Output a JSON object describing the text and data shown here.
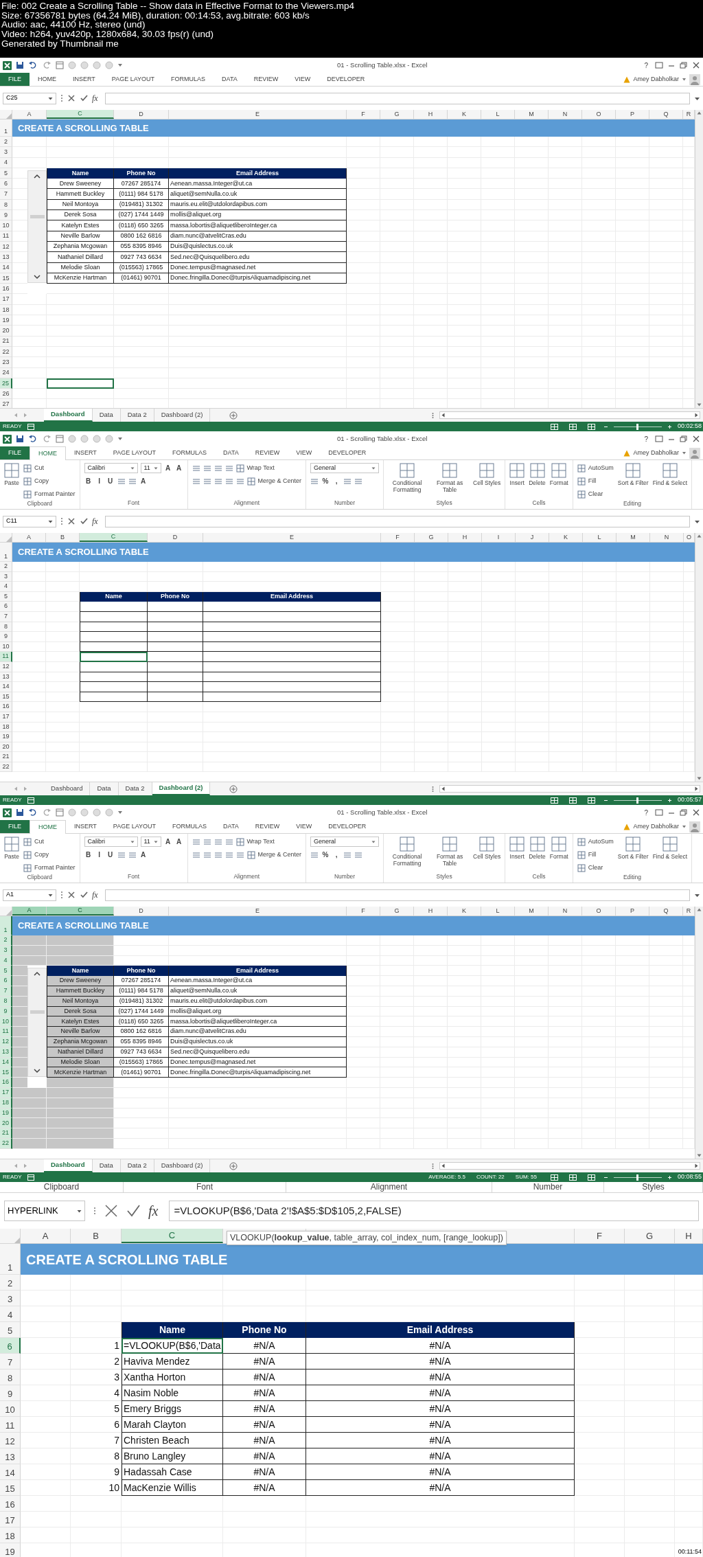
{
  "video_info": [
    "File: 002 Create a Scrolling Table -- Show data in Effective Format to the Viewers.mp4",
    "Size: 67356781 bytes (64.24 MiB), duration: 00:14:53, avg.bitrate: 603 kb/s",
    "Audio: aac, 44100 Hz, stereo (und)",
    "Video: h264, yuv420p, 1280x684, 30.03 fps(r) (und)",
    "Generated by Thumbnail me"
  ],
  "frames": [
    {
      "kind": "window",
      "timestamp": "00:02:58",
      "window": {
        "title": "01 - Scrolling Table.xlsx - Excel",
        "help": "?",
        "user": "Amey Dabholkar"
      },
      "file_button": {
        "label": "FILE"
      },
      "ribbon_tabs": [
        {
          "label": "HOME",
          "selected": false
        },
        {
          "label": "INSERT",
          "selected": false
        },
        {
          "label": "PAGE LAYOUT",
          "selected": false
        },
        {
          "label": "FORMULAS",
          "selected": false
        },
        {
          "label": "DATA",
          "selected": false
        },
        {
          "label": "REVIEW",
          "selected": false
        },
        {
          "label": "VIEW",
          "selected": false
        },
        {
          "label": "DEVELOPER",
          "selected": false
        }
      ],
      "formula_bar": {
        "name_box": "C25",
        "function_label": "fx"
      },
      "sheet": {
        "banner": "CREATE A SCROLLING TABLE",
        "scroll_control": true,
        "columns": [
          {
            "label": "A",
            "selected": false
          },
          {
            "label": "C",
            "selected": true
          },
          {
            "label": "D",
            "selected": false
          },
          {
            "label": "E",
            "selected": false
          },
          {
            "label": "F",
            "selected": false
          },
          {
            "label": "G",
            "selected": false
          },
          {
            "label": "H",
            "selected": false
          },
          {
            "label": "K",
            "selected": false
          },
          {
            "label": "L",
            "selected": false
          },
          {
            "label": "M",
            "selected": false
          },
          {
            "label": "N",
            "selected": false
          },
          {
            "label": "O",
            "selected": false
          },
          {
            "label": "P",
            "selected": false
          },
          {
            "label": "Q",
            "selected": false
          },
          {
            "label": "R",
            "selected": false
          }
        ],
        "rows": [
          {
            "label": "1",
            "selected": false
          },
          {
            "label": "2",
            "selected": false
          },
          {
            "label": "3",
            "selected": false
          },
          {
            "label": "4",
            "selected": false
          },
          {
            "label": "5",
            "selected": false
          },
          {
            "label": "6",
            "selected": false
          },
          {
            "label": "7",
            "selected": false
          },
          {
            "label": "8",
            "selected": false
          },
          {
            "label": "9",
            "selected": false
          },
          {
            "label": "10",
            "selected": false
          },
          {
            "label": "11",
            "selected": false
          },
          {
            "label": "12",
            "selected": false
          },
          {
            "label": "13",
            "selected": false
          },
          {
            "label": "14",
            "selected": false
          },
          {
            "label": "15",
            "selected": false
          },
          {
            "label": "16",
            "selected": false
          },
          {
            "label": "17",
            "selected": false
          },
          {
            "label": "18",
            "selected": false
          },
          {
            "label": "19",
            "selected": false
          },
          {
            "label": "20",
            "selected": false
          },
          {
            "label": "21",
            "selected": false
          },
          {
            "label": "22",
            "selected": false
          },
          {
            "label": "23",
            "selected": false
          },
          {
            "label": "24",
            "selected": false
          },
          {
            "label": "25",
            "selected": true
          },
          {
            "label": "26",
            "selected": false
          },
          {
            "label": "27",
            "selected": false
          }
        ],
        "table": {
          "columns": [
            "Name",
            "Phone No",
            "Email Address"
          ],
          "rows": [
            {
              "name": "Drew Sweeney",
              "phone": "07267 285174",
              "email": "Aenean.massa.Integer@ut.ca"
            },
            {
              "name": "Hammett Buckley",
              "phone": "(0111) 984 5178",
              "email": "aliquet@semNulla.co.uk"
            },
            {
              "name": "Neil Montoya",
              "phone": "(019481) 31302",
              "email": "mauris.eu.elit@utdolordapibus.com"
            },
            {
              "name": "Derek Sosa",
              "phone": "(027) 1744 1449",
              "email": "mollis@aliquet.org"
            },
            {
              "name": "Katelyn Estes",
              "phone": "(0118) 650 3265",
              "email": "massa.lobortis@aliquetliberoInteger.ca"
            },
            {
              "name": "Neville Barlow",
              "phone": "0800 162 6816",
              "email": "diam.nunc@atvelitCras.edu"
            },
            {
              "name": "Zephania Mcgowan",
              "phone": "055 8395 8946",
              "email": "Duis@quislectus.co.uk"
            },
            {
              "name": "Nathaniel Dillard",
              "phone": "0927 743 6634",
              "email": "Sed.nec@Quisquelibero.edu"
            },
            {
              "name": "Melodie Sloan",
              "phone": "(015563) 17865",
              "email": "Donec.tempus@magnased.net"
            },
            {
              "name": "McKenzie Hartman",
              "phone": "(01461) 90701",
              "email": "Donec.fringilla.Donec@turpisAliquamadipiscing.net"
            }
          ]
        }
      },
      "sheet_tabs": [
        {
          "label": "Dashboard",
          "selected": true
        },
        {
          "label": "Data",
          "selected": false
        },
        {
          "label": "Data 2",
          "selected": false
        },
        {
          "label": "Dashboard (2)",
          "selected": false
        }
      ],
      "status_bar": {
        "mode": "READY",
        "zoom": {
          "level": 0.5
        }
      }
    },
    {
      "kind": "window",
      "timestamp": "00:05:57",
      "window": {
        "title": "01 - Scrolling Table.xlsx - Excel",
        "help": "?",
        "user": "Amey Dabholkar"
      },
      "file_button": {
        "label": "FILE"
      },
      "ribbon_tabs": [
        {
          "label": "HOME",
          "selected": true
        },
        {
          "label": "INSERT",
          "selected": false
        },
        {
          "label": "PAGE LAYOUT",
          "selected": false
        },
        {
          "label": "FORMULAS",
          "selected": false
        },
        {
          "label": "DATA",
          "selected": false
        },
        {
          "label": "REVIEW",
          "selected": false
        },
        {
          "label": "VIEW",
          "selected": false
        },
        {
          "label": "DEVELOPER",
          "selected": false
        }
      ],
      "ribbon": {
        "groups": [
          {
            "label": "Clipboard",
            "items": [
              {
                "kind": "large",
                "label": "Paste"
              },
              {
                "kind": "stack",
                "lines": [
                  {
                    "tools": [
                      {
                        "kind": "labeled",
                        "label": "Cut"
                      }
                    ]
                  },
                  {
                    "tools": [
                      {
                        "kind": "labeled",
                        "label": "Copy"
                      }
                    ]
                  },
                  {
                    "tools": [
                      {
                        "kind": "labeled",
                        "label": "Format Painter"
                      }
                    ]
                  }
                ]
              }
            ]
          },
          {
            "label": "Font",
            "items": [
              {
                "kind": "stack",
                "lines": [
                  {
                    "tools": [
                      {
                        "kind": "field",
                        "label": "Calibri"
                      },
                      {
                        "kind": "field",
                        "label": "11"
                      },
                      {
                        "kind": "text",
                        "label": "A"
                      },
                      {
                        "kind": "text",
                        "label": "A"
                      }
                    ]
                  },
                  {
                    "tools": [
                      {
                        "kind": "text",
                        "label": "B"
                      },
                      {
                        "kind": "text",
                        "label": "I"
                      },
                      {
                        "kind": "text",
                        "label": "U"
                      },
                      {
                        "kind": "icon"
                      },
                      {
                        "kind": "icon"
                      },
                      {
                        "kind": "text",
                        "label": "A"
                      }
                    ]
                  }
                ]
              }
            ]
          },
          {
            "label": "Alignment",
            "items": [
              {
                "kind": "stack",
                "lines": [
                  {
                    "tools": [
                      {
                        "kind": "icon"
                      },
                      {
                        "kind": "icon"
                      },
                      {
                        "kind": "icon"
                      },
                      {
                        "kind": "icon"
                      },
                      {
                        "kind": "labeled",
                        "label": "Wrap Text"
                      }
                    ]
                  },
                  {
                    "tools": [
                      {
                        "kind": "icon"
                      },
                      {
                        "kind": "icon"
                      },
                      {
                        "kind": "icon"
                      },
                      {
                        "kind": "icon"
                      },
                      {
                        "kind": "icon"
                      },
                      {
                        "kind": "labeled",
                        "label": "Merge & Center"
                      }
                    ]
                  }
                ]
              }
            ]
          },
          {
            "label": "Number",
            "items": [
              {
                "kind": "stack",
                "lines": [
                  {
                    "tools": [
                      {
                        "kind": "field",
                        "label": "General"
                      }
                    ]
                  },
                  {
                    "tools": [
                      {
                        "kind": "icon"
                      },
                      {
                        "kind": "text",
                        "label": "%"
                      },
                      {
                        "kind": "text",
                        "label": ","
                      },
                      {
                        "kind": "icon"
                      },
                      {
                        "kind": "icon"
                      }
                    ]
                  }
                ]
              }
            ]
          },
          {
            "label": "Styles",
            "items": [
              {
                "kind": "large",
                "label": "Conditional Formatting"
              },
              {
                "kind": "large",
                "label": "Format as Table"
              },
              {
                "kind": "large",
                "label": "Cell Styles"
              }
            ]
          },
          {
            "label": "Cells",
            "items": [
              {
                "kind": "large",
                "label": "Insert"
              },
              {
                "kind": "large",
                "label": "Delete"
              },
              {
                "kind": "large",
                "label": "Format"
              }
            ]
          },
          {
            "label": "Editing",
            "items": [
              {
                "kind": "stack",
                "lines": [
                  {
                    "tools": [
                      {
                        "kind": "labeled",
                        "label": "AutoSum"
                      }
                    ]
                  },
                  {
                    "tools": [
                      {
                        "kind": "labeled",
                        "label": "Fill"
                      }
                    ]
                  },
                  {
                    "tools": [
                      {
                        "kind": "labeled",
                        "label": "Clear"
                      }
                    ]
                  }
                ]
              },
              {
                "kind": "large",
                "label": "Sort & Filter"
              },
              {
                "kind": "large",
                "label": "Find & Select"
              }
            ]
          }
        ]
      },
      "formula_bar": {
        "name_box": "C11",
        "function_label": "fx"
      },
      "sheet": {
        "banner": "CREATE A SCROLLING TABLE",
        "columns": [
          {
            "label": "A",
            "selected": false
          },
          {
            "label": "B",
            "selected": false
          },
          {
            "label": "C",
            "selected": true
          },
          {
            "label": "D",
            "selected": false
          },
          {
            "label": "E",
            "selected": false
          },
          {
            "label": "F",
            "selected": false
          },
          {
            "label": "G",
            "selected": false
          },
          {
            "label": "H",
            "selected": false
          },
          {
            "label": "I",
            "selected": false
          },
          {
            "label": "J",
            "selected": false
          },
          {
            "label": "K",
            "selected": false
          },
          {
            "label": "L",
            "selected": false
          },
          {
            "label": "M",
            "selected": false
          },
          {
            "label": "N",
            "selected": false
          },
          {
            "label": "O",
            "selected": false
          }
        ],
        "rows": [
          {
            "label": "1",
            "selected": false
          },
          {
            "label": "2",
            "selected": false
          },
          {
            "label": "3",
            "selected": false
          },
          {
            "label": "4",
            "selected": false
          },
          {
            "label": "5",
            "selected": false
          },
          {
            "label": "6",
            "selected": false
          },
          {
            "label": "7",
            "selected": false
          },
          {
            "label": "8",
            "selected": false
          },
          {
            "label": "9",
            "selected": false
          },
          {
            "label": "10",
            "selected": false
          },
          {
            "label": "11",
            "selected": true
          },
          {
            "label": "12",
            "selected": false
          },
          {
            "label": "13",
            "selected": false
          },
          {
            "label": "14",
            "selected": false
          },
          {
            "label": "15",
            "selected": false
          },
          {
            "label": "16",
            "selected": false
          },
          {
            "label": "17",
            "selected": false
          },
          {
            "label": "18",
            "selected": false
          },
          {
            "label": "19",
            "selected": false
          },
          {
            "label": "20",
            "selected": false
          },
          {
            "label": "21",
            "selected": false
          },
          {
            "label": "22",
            "selected": false
          }
        ],
        "table": {
          "columns": [
            "Name",
            "Phone No",
            "Email Address"
          ],
          "rows": [
            {},
            {},
            {},
            {},
            {},
            {},
            {},
            {},
            {},
            {}
          ]
        }
      },
      "sheet_tabs": [
        {
          "label": "Dashboard",
          "selected": false
        },
        {
          "label": "Data",
          "selected": false
        },
        {
          "label": "Data 2",
          "selected": false
        },
        {
          "label": "Dashboard (2)",
          "selected": true
        }
      ],
      "status_bar": {
        "mode": "READY",
        "zoom": {
          "level": 0.5
        }
      }
    },
    {
      "kind": "window",
      "timestamp": "00:08:55",
      "window": {
        "title": "01 - Scrolling Table.xlsx - Excel",
        "help": "?",
        "user": "Amey Dabholkar"
      },
      "file_button": {
        "label": "FILE"
      },
      "ribbon_tabs": [
        {
          "label": "HOME",
          "selected": true
        },
        {
          "label": "INSERT",
          "selected": false
        },
        {
          "label": "PAGE LAYOUT",
          "selected": false
        },
        {
          "label": "FORMULAS",
          "selected": false
        },
        {
          "label": "DATA",
          "selected": false
        },
        {
          "label": "REVIEW",
          "selected": false
        },
        {
          "label": "VIEW",
          "selected": false
        },
        {
          "label": "DEVELOPER",
          "selected": false
        }
      ],
      "ribbon": {
        "groups": [
          {
            "label": "Clipboard",
            "items": [
              {
                "kind": "large",
                "label": "Paste"
              },
              {
                "kind": "stack",
                "lines": [
                  {
                    "tools": [
                      {
                        "kind": "labeled",
                        "label": "Cut"
                      }
                    ]
                  },
                  {
                    "tools": [
                      {
                        "kind": "labeled",
                        "label": "Copy"
                      }
                    ]
                  },
                  {
                    "tools": [
                      {
                        "kind": "labeled",
                        "label": "Format Painter"
                      }
                    ]
                  }
                ]
              }
            ]
          },
          {
            "label": "Font",
            "items": [
              {
                "kind": "stack",
                "lines": [
                  {
                    "tools": [
                      {
                        "kind": "field",
                        "label": "Calibri"
                      },
                      {
                        "kind": "field",
                        "label": "11"
                      },
                      {
                        "kind": "text",
                        "label": "A"
                      },
                      {
                        "kind": "text",
                        "label": "A"
                      }
                    ]
                  },
                  {
                    "tools": [
                      {
                        "kind": "text",
                        "label": "B"
                      },
                      {
                        "kind": "text",
                        "label": "I"
                      },
                      {
                        "kind": "text",
                        "label": "U"
                      },
                      {
                        "kind": "icon"
                      },
                      {
                        "kind": "icon"
                      },
                      {
                        "kind": "text",
                        "label": "A"
                      }
                    ]
                  }
                ]
              }
            ]
          },
          {
            "label": "Alignment",
            "items": [
              {
                "kind": "stack",
                "lines": [
                  {
                    "tools": [
                      {
                        "kind": "icon"
                      },
                      {
                        "kind": "icon"
                      },
                      {
                        "kind": "icon"
                      },
                      {
                        "kind": "icon"
                      },
                      {
                        "kind": "labeled",
                        "label": "Wrap Text"
                      }
                    ]
                  },
                  {
                    "tools": [
                      {
                        "kind": "icon"
                      },
                      {
                        "kind": "icon"
                      },
                      {
                        "kind": "icon"
                      },
                      {
                        "kind": "icon"
                      },
                      {
                        "kind": "icon"
                      },
                      {
                        "kind": "labeled",
                        "label": "Merge & Center"
                      }
                    ]
                  }
                ]
              }
            ]
          },
          {
            "label": "Number",
            "items": [
              {
                "kind": "stack",
                "lines": [
                  {
                    "tools": [
                      {
                        "kind": "field",
                        "label": "General"
                      }
                    ]
                  },
                  {
                    "tools": [
                      {
                        "kind": "icon"
                      },
                      {
                        "kind": "text",
                        "label": "%"
                      },
                      {
                        "kind": "text",
                        "label": ","
                      },
                      {
                        "kind": "icon"
                      },
                      {
                        "kind": "icon"
                      }
                    ]
                  }
                ]
              }
            ]
          },
          {
            "label": "Styles",
            "items": [
              {
                "kind": "large",
                "label": "Conditional Formatting"
              },
              {
                "kind": "large",
                "label": "Format as Table"
              },
              {
                "kind": "large",
                "label": "Cell Styles"
              }
            ]
          },
          {
            "label": "Cells",
            "items": [
              {
                "kind": "large",
                "label": "Insert"
              },
              {
                "kind": "large",
                "label": "Delete"
              },
              {
                "kind": "large",
                "label": "Format"
              }
            ]
          },
          {
            "label": "Editing",
            "items": [
              {
                "kind": "stack",
                "lines": [
                  {
                    "tools": [
                      {
                        "kind": "labeled",
                        "label": "AutoSum"
                      }
                    ]
                  },
                  {
                    "tools": [
                      {
                        "kind": "labeled",
                        "label": "Fill"
                      }
                    ]
                  },
                  {
                    "tools": [
                      {
                        "kind": "labeled",
                        "label": "Clear"
                      }
                    ]
                  }
                ]
              },
              {
                "kind": "large",
                "label": "Sort & Filter"
              },
              {
                "kind": "large",
                "label": "Find & Select"
              }
            ]
          }
        ]
      },
      "formula_bar": {
        "name_box": "A1",
        "function_label": "fx"
      },
      "sheet": {
        "banner": "CREATE A SCROLLING TABLE",
        "scroll_control": true,
        "columns": [
          {
            "label": "A",
            "selected": true,
            "shaded": true
          },
          {
            "label": "C",
            "selected": true,
            "shaded": true
          },
          {
            "label": "D",
            "selected": false,
            "shaded": false
          },
          {
            "label": "E",
            "selected": false,
            "shaded": false
          },
          {
            "label": "F",
            "selected": false,
            "shaded": false
          },
          {
            "label": "G",
            "selected": false,
            "shaded": false
          },
          {
            "label": "H",
            "selected": false,
            "shaded": false
          },
          {
            "label": "K",
            "selected": false,
            "shaded": false
          },
          {
            "label": "L",
            "selected": false,
            "shaded": false
          },
          {
            "label": "M",
            "selected": false,
            "shaded": false
          },
          {
            "label": "N",
            "selected": false,
            "shaded": false
          },
          {
            "label": "O",
            "selected": false,
            "shaded": false
          },
          {
            "label": "P",
            "selected": false,
            "shaded": false
          },
          {
            "label": "Q",
            "selected": false,
            "shaded": false
          },
          {
            "label": "R",
            "selected": false,
            "shaded": false
          }
        ],
        "rows": [
          {
            "label": "1",
            "selected": true
          },
          {
            "label": "2",
            "selected": true
          },
          {
            "label": "3",
            "selected": true
          },
          {
            "label": "4",
            "selected": true
          },
          {
            "label": "5",
            "selected": true
          },
          {
            "label": "6",
            "selected": true
          },
          {
            "label": "7",
            "selected": true
          },
          {
            "label": "8",
            "selected": true
          },
          {
            "label": "9",
            "selected": true
          },
          {
            "label": "10",
            "selected": true
          },
          {
            "label": "11",
            "selected": true
          },
          {
            "label": "12",
            "selected": true
          },
          {
            "label": "13",
            "selected": true
          },
          {
            "label": "14",
            "selected": true
          },
          {
            "label": "15",
            "selected": true
          },
          {
            "label": "16",
            "selected": true
          },
          {
            "label": "17",
            "selected": true
          },
          {
            "label": "18",
            "selected": true
          },
          {
            "label": "19",
            "selected": true
          },
          {
            "label": "20",
            "selected": true
          },
          {
            "label": "21",
            "selected": true
          },
          {
            "label": "22",
            "selected": true
          }
        ],
        "table": {
          "columns": [
            "Name",
            "Phone No",
            "Email Address"
          ],
          "rows": [
            {
              "name": "Drew Sweeney",
              "phone": "07267 285174",
              "email": "Aenean.massa.Integer@ut.ca"
            },
            {
              "name": "Hammett Buckley",
              "phone": "(0111) 984 5178",
              "email": "aliquet@semNulla.co.uk"
            },
            {
              "name": "Neil Montoya",
              "phone": "(019481) 31302",
              "email": "mauris.eu.elit@utdolordapibus.com"
            },
            {
              "name": "Derek Sosa",
              "phone": "(027) 1744 1449",
              "email": "mollis@aliquet.org"
            },
            {
              "name": "Katelyn Estes",
              "phone": "(0118) 650 3265",
              "email": "massa.lobortis@aliquetliberoInteger.ca"
            },
            {
              "name": "Neville Barlow",
              "phone": "0800 162 6816",
              "email": "diam.nunc@atvelitCras.edu"
            },
            {
              "name": "Zephania Mcgowan",
              "phone": "055 8395 8946",
              "email": "Duis@quislectus.co.uk"
            },
            {
              "name": "Nathaniel Dillard",
              "phone": "0927 743 6634",
              "email": "Sed.nec@Quisquelibero.edu"
            },
            {
              "name": "Melodie Sloan",
              "phone": "(015563) 17865",
              "email": "Donec.tempus@magnased.net"
            },
            {
              "name": "McKenzie Hartman",
              "phone": "(01461) 90701",
              "email": "Donec.fringilla.Donec@turpisAliquamadipiscing.net"
            }
          ]
        }
      },
      "sheet_tabs": [
        {
          "label": "Dashboard",
          "selected": true
        },
        {
          "label": "Data",
          "selected": false
        },
        {
          "label": "Data 2",
          "selected": false
        },
        {
          "label": "Dashboard (2)",
          "selected": false
        }
      ],
      "status_bar": {
        "mode": "READY",
        "stats": [
          "AVERAGE: 5.5",
          "COUNT: 22",
          "SUM: 55"
        ],
        "zoom": {
          "level": 0.5
        }
      }
    },
    {
      "kind": "zoomed",
      "timestamp": "00:11:54",
      "ribbon": {
        "groups": [
          {
            "label": "Clipboard"
          },
          {
            "label": "Font"
          },
          {
            "label": "Alignment"
          },
          {
            "label": "Number"
          },
          {
            "label": "Styles"
          }
        ]
      },
      "formula_bar": {
        "name_box": "HYPERLINK",
        "function_label": "fx",
        "formula": "=VLOOKUP(B$6,'Data 2'!$A$5:$D$105,2,FALSE)",
        "tooltip": "VLOOKUP(**lookup_value**, table_array, col_index_num, [range_lookup])"
      },
      "sheet": {
        "banner": "CREATE A SCROLLING TABLE",
        "columns": [
          {
            "label": "A",
            "selected": false
          },
          {
            "label": "B",
            "selected": false
          },
          {
            "label": "C",
            "selected": true
          },
          {
            "selected": false
          },
          {
            "selected": false
          },
          {
            "label": "F",
            "selected": false
          },
          {
            "label": "G",
            "selected": false
          },
          {
            "label": "H",
            "selected": false
          }
        ],
        "rows": [
          {
            "label": "1",
            "selected": false
          },
          {
            "label": "2",
            "selected": false
          },
          {
            "label": "3",
            "selected": false
          },
          {
            "label": "4",
            "selected": false
          },
          {
            "label": "5",
            "selected": false
          },
          {
            "label": "6",
            "selected": true
          },
          {
            "label": "7",
            "selected": false
          },
          {
            "label": "8",
            "selected": false
          },
          {
            "label": "9",
            "selected": false
          },
          {
            "label": "10",
            "selected": false
          },
          {
            "label": "11",
            "selected": false
          },
          {
            "label": "12",
            "selected": false
          },
          {
            "label": "13",
            "selected": false
          },
          {
            "label": "14",
            "selected": false
          },
          {
            "label": "15",
            "selected": false
          },
          {
            "label": "16",
            "selected": false
          },
          {
            "label": "17",
            "selected": false
          },
          {
            "label": "18",
            "selected": false
          },
          {
            "label": "19",
            "selected": false
          }
        ],
        "table": {
          "columns": [
            "Name",
            "Phone No",
            "Email Address"
          ],
          "rows": [
            {
              "number": "1",
              "name": "=VLOOKUP(B$6,'Data",
              "phone": "#N/A",
              "email": "#N/A"
            },
            {
              "number": "2",
              "name": "Haviva Mendez",
              "phone": "#N/A",
              "email": "#N/A"
            },
            {
              "number": "3",
              "name": "Xantha Horton",
              "phone": "#N/A",
              "email": "#N/A"
            },
            {
              "number": "4",
              "name": "Nasim Noble",
              "phone": "#N/A",
              "email": "#N/A"
            },
            {
              "number": "5",
              "name": "Emery Briggs",
              "phone": "#N/A",
              "email": "#N/A"
            },
            {
              "number": "6",
              "name": "Marah Clayton",
              "phone": "#N/A",
              "email": "#N/A"
            },
            {
              "number": "7",
              "name": "Christen Beach",
              "phone": "#N/A",
              "email": "#N/A"
            },
            {
              "number": "8",
              "name": "Bruno Langley",
              "phone": "#N/A",
              "email": "#N/A"
            },
            {
              "number": "9",
              "name": "Hadassah Case",
              "phone": "#N/A",
              "email": "#N/A"
            },
            {
              "number": "10",
              "name": "MacKenzie Willis",
              "phone": "#N/A",
              "email": "#N/A"
            }
          ]
        }
      }
    }
  ]
}
